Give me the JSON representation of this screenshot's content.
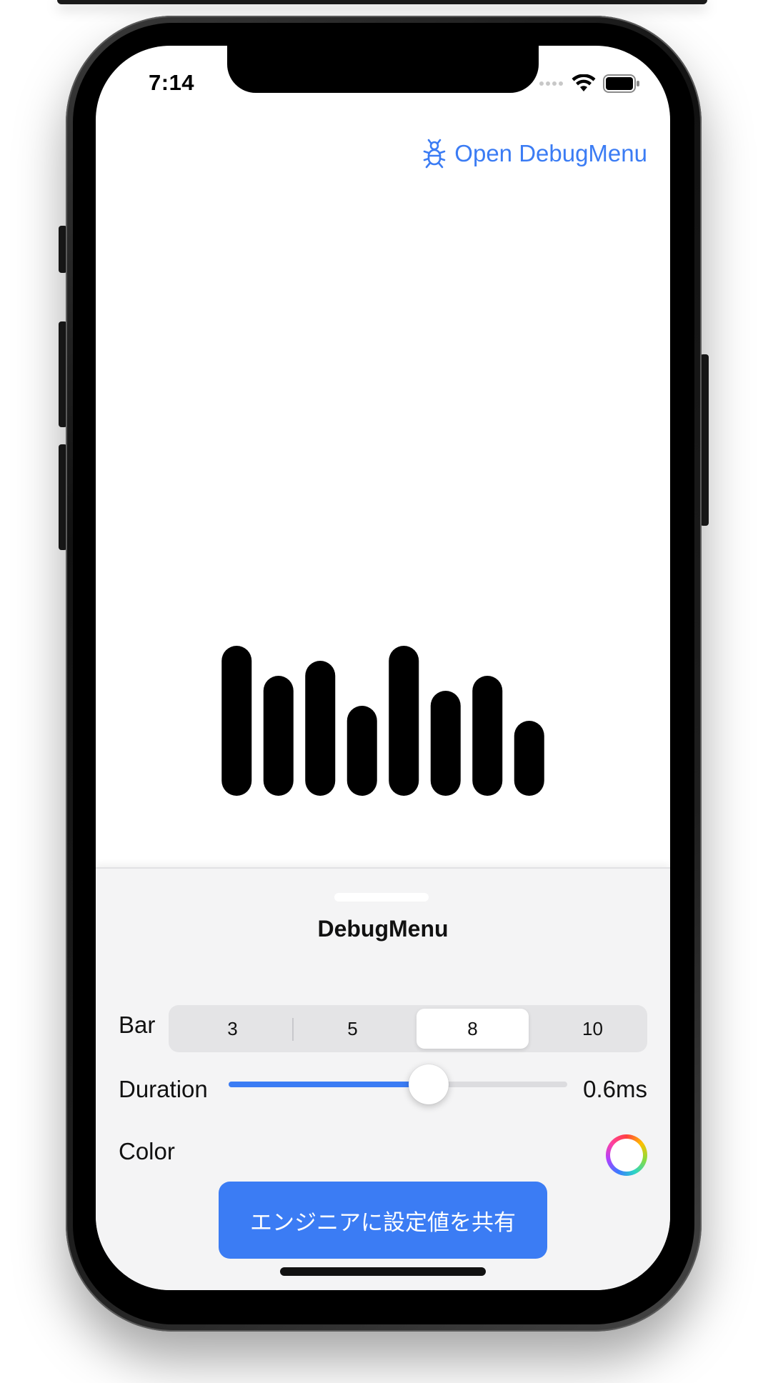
{
  "status_bar": {
    "time": "7:14",
    "wifi_icon": "wifi-icon",
    "battery_icon": "battery-icon"
  },
  "nav": {
    "debug_button_label": "Open DebugMenu",
    "debug_icon": "bug-icon",
    "accent": "#3b7cf4"
  },
  "visualizer": {
    "bar_color": "#000000",
    "levels": [
      1.0,
      0.8,
      0.9,
      0.6,
      1.0,
      0.7,
      0.8,
      0.5
    ]
  },
  "debug_menu": {
    "title": "DebugMenu",
    "bar": {
      "label": "Bar",
      "options": [
        "3",
        "5",
        "8",
        "10"
      ],
      "selected": "8"
    },
    "duration": {
      "label": "Duration",
      "value_text": "0.6ms",
      "fraction": 0.59
    },
    "color": {
      "label": "Color",
      "icon": "color-wheel-icon"
    },
    "share_button_label": "エンジニアに設定値を共有"
  }
}
